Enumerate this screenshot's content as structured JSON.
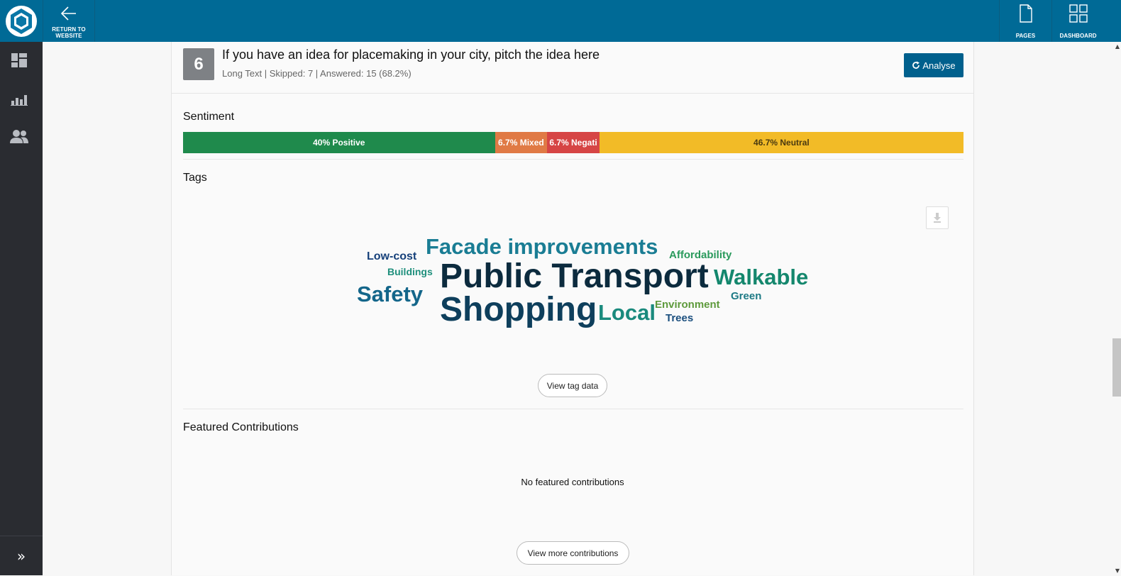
{
  "topbar": {
    "return_label_line1": "RETURN TO",
    "return_label_line2": "WEBSITE",
    "pages_label": "PAGES",
    "dashboard_label": "DASHBOARD"
  },
  "question": {
    "number": "6",
    "title": "If you have an idea for placemaking in your city, pitch the idea here",
    "meta": "Long Text | Skipped: 7 | Answered: 15 (68.2%)",
    "analyse_label": "Analyse"
  },
  "sentiment": {
    "title": "Sentiment",
    "segments": [
      {
        "label": "40% Positive",
        "share": 40,
        "color": "#1f8a4c"
      },
      {
        "label": "6.7% Mixed",
        "share": 6.7,
        "color": "#e07a45"
      },
      {
        "label": "6.7% Negati",
        "share": 6.7,
        "color": "#d64545"
      },
      {
        "label": "46.7% Neutral",
        "share": 46.7,
        "color": "#f2bb27"
      }
    ]
  },
  "tags": {
    "title": "Tags",
    "words": [
      {
        "text": "Facade improvements",
        "color": "#1a7d94"
      },
      {
        "text": "Low-cost",
        "color": "#16407a"
      },
      {
        "text": "Affordability",
        "color": "#2a9a5c"
      },
      {
        "text": "Buildings",
        "color": "#1e8f7c"
      },
      {
        "text": "Public Transport",
        "color": "#0c2b3e"
      },
      {
        "text": "Walkable",
        "color": "#14876d"
      },
      {
        "text": "Safety",
        "color": "#14668a"
      },
      {
        "text": "Green",
        "color": "#1d7a85"
      },
      {
        "text": "Shopping",
        "color": "#0e3f5c"
      },
      {
        "text": "Local",
        "color": "#1a8a7d"
      },
      {
        "text": "Environment",
        "color": "#5e9a3c"
      },
      {
        "text": "Trees",
        "color": "#1b4f7e"
      }
    ],
    "view_tag_data_label": "View tag data"
  },
  "featured": {
    "title": "Featured Contributions",
    "empty_message": "No featured contributions",
    "view_more_label": "View more contributions"
  }
}
